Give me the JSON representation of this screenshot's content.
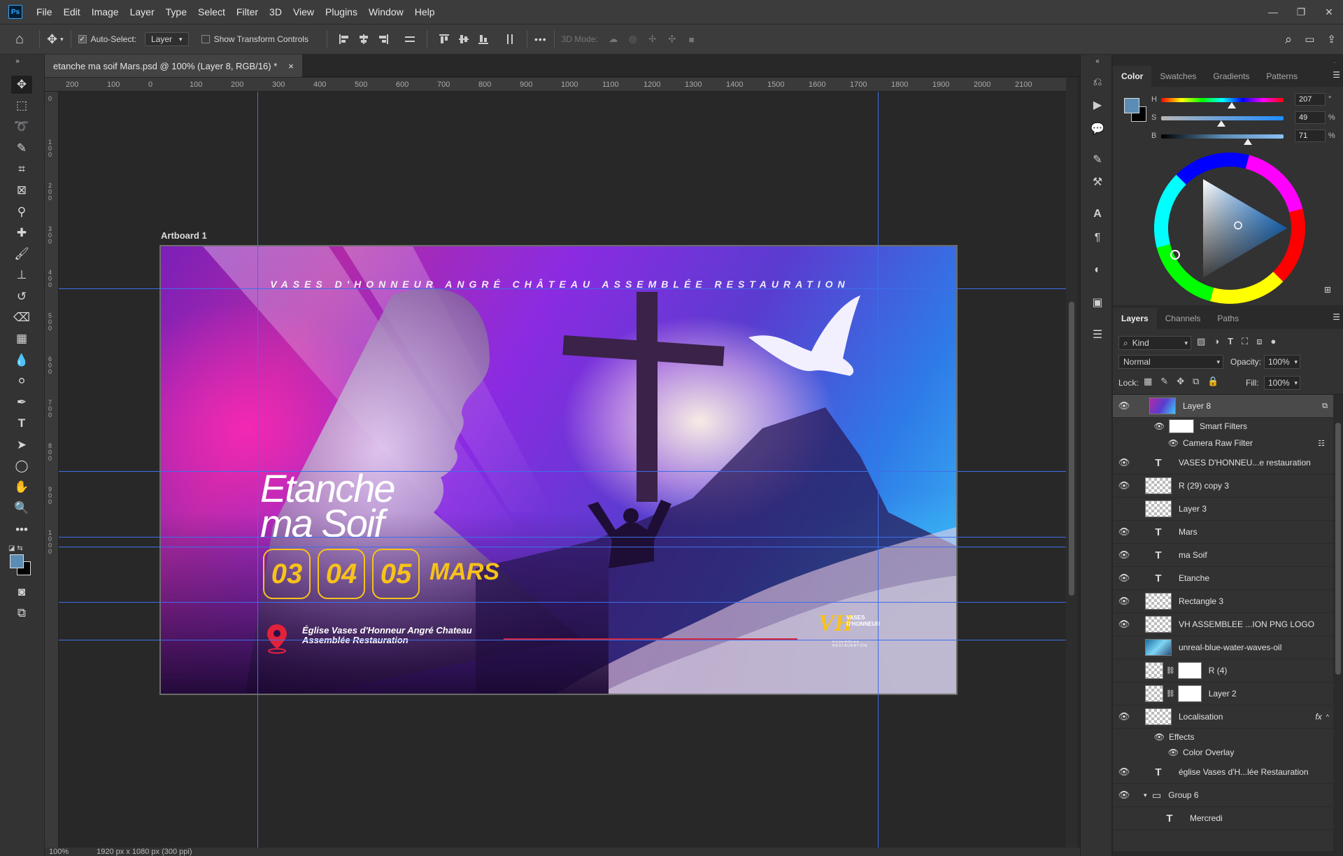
{
  "menubar": {
    "logo": "Ps",
    "items": [
      "File",
      "Edit",
      "Image",
      "Layer",
      "Type",
      "Select",
      "Filter",
      "3D",
      "View",
      "Plugins",
      "Window",
      "Help"
    ]
  },
  "options": {
    "auto_select_label": "Auto-Select:",
    "auto_select_target": "Layer",
    "transform_label": "Show Transform Controls",
    "mode3d_label": "3D Mode:",
    "more": "•••"
  },
  "document": {
    "tab_title": "etanche ma soif Mars.psd @ 100% (Layer 8, RGB/16) *",
    "close": "×",
    "artboard_label": "Artboard 1",
    "zoom": "100%",
    "doc_size": "1920 px x 1080 px (300 ppi)"
  },
  "ruler": {
    "h": [
      "200",
      "100",
      "0",
      "100",
      "200",
      "300",
      "400",
      "500",
      "600",
      "700",
      "800",
      "900",
      "1000",
      "1100",
      "1200",
      "1300",
      "1400",
      "1500",
      "1600",
      "1700",
      "1800",
      "1900",
      "2000",
      "2100"
    ],
    "v": [
      "0",
      "1 0 0",
      "2 0 0",
      "3 0 0",
      "4 0 0",
      "5 0 0",
      "6 0 0",
      "7 0 0",
      "8 0 0",
      "9 0 0",
      "1 0 0 0"
    ]
  },
  "flyer": {
    "tagline": "VASES D'HONNEUR ANGRÉ CHÂTEAU ASSEMBLÉE RESTAURATION",
    "title_line1": "Etanche",
    "title_line2": "ma Soif",
    "dates": [
      "03",
      "04",
      "05"
    ],
    "month": "MARS",
    "church_line1": "Église Vases d'Honneur Angré Chateau",
    "church_line2": "Assemblée Restauration",
    "logo_mark": "VH",
    "logo_line1": "VASES",
    "logo_line2": "D'HONNEUR",
    "logo_line3": "ASSEMBLÉE RESTAURATION"
  },
  "color_panel": {
    "tabs": [
      "Color",
      "Swatches",
      "Gradients",
      "Patterns"
    ],
    "h_label": "H",
    "h": "207",
    "h_unit": "°",
    "s_label": "S",
    "s": "49",
    "s_unit": "%",
    "b_label": "B",
    "b": "71",
    "b_unit": "%",
    "foreground": "#5b8cb5",
    "background": "#000000"
  },
  "layers_panel": {
    "tabs": [
      "Layers",
      "Channels",
      "Paths"
    ],
    "kind": "Kind",
    "blend": "Normal",
    "opacity_label": "Opacity:",
    "opacity": "100%",
    "lock_label": "Lock:",
    "fill_label": "Fill:",
    "fill": "100%",
    "layers": [
      {
        "name": "Layer 8",
        "type": "image",
        "visible": true
      },
      {
        "name": "VASES D'HONNEU...e restauration",
        "type": "text",
        "visible": true
      },
      {
        "name": "R (29) copy 3",
        "type": "image",
        "visible": true
      },
      {
        "name": "Layer 3",
        "type": "image",
        "visible": false
      },
      {
        "name": "Mars",
        "type": "text",
        "visible": true
      },
      {
        "name": "ma Soif",
        "type": "text",
        "visible": true
      },
      {
        "name": "Etanche",
        "type": "text",
        "visible": true
      },
      {
        "name": "Rectangle 3",
        "type": "image",
        "visible": true
      },
      {
        "name": "VH ASSEMBLEE ...ION PNG LOGO",
        "type": "image",
        "visible": true
      },
      {
        "name": "unreal-blue-water-waves-oil",
        "type": "image",
        "visible": false
      },
      {
        "name": "R (4)",
        "type": "image",
        "visible": false
      },
      {
        "name": "Layer 2",
        "type": "image",
        "visible": false
      },
      {
        "name": "Localisation",
        "type": "image",
        "visible": true
      },
      {
        "name": "église Vases d'H...lée Restauration",
        "type": "text",
        "visible": true
      },
      {
        "name": "Group 6",
        "type": "group",
        "visible": true
      },
      {
        "name": "Mercredi",
        "type": "text",
        "visible": false
      }
    ],
    "smart_filters": "Smart Filters",
    "camera_raw": "Camera Raw Filter",
    "effects": "Effects",
    "color_overlay": "Color Overlay",
    "fx": "fx"
  }
}
